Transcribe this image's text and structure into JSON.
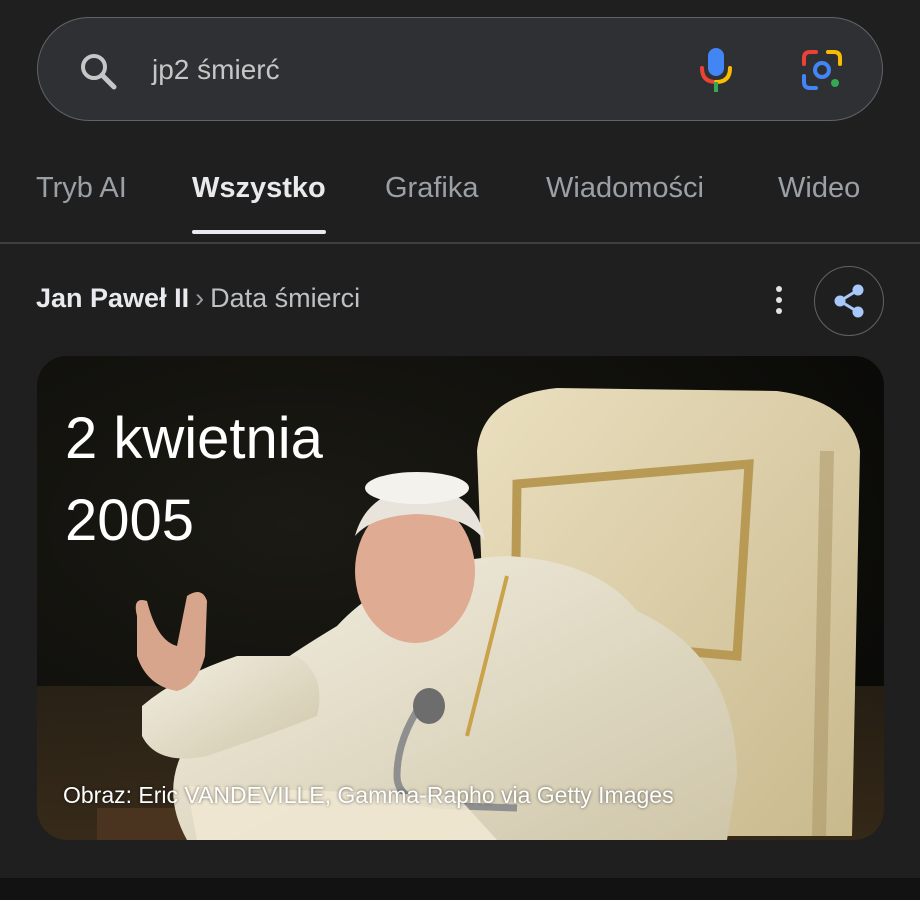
{
  "search": {
    "query": "jp2 śmierć",
    "icons": [
      "search-icon",
      "microphone-icon",
      "google-lens-icon"
    ]
  },
  "tabs": [
    {
      "label": "Tryb AI",
      "active": false
    },
    {
      "label": "Wszystko",
      "active": true
    },
    {
      "label": "Grafika",
      "active": false
    },
    {
      "label": "Wiadomości",
      "active": false
    },
    {
      "label": "Wideo",
      "active": false
    }
  ],
  "breadcrumb": {
    "entity": "Jan Paweł II",
    "separator": "›",
    "attribute": "Data śmierci"
  },
  "result": {
    "date_line1": "2 kwietnia",
    "date_line2": "2005",
    "image_credit": "Obraz: Eric VANDEVILLE, Gamma-Rapho via Getty Images"
  },
  "colors": {
    "background": "#1f1f1f",
    "search_bar": "#2f3033",
    "active_tab": "#e8eaed",
    "inactive_tab": "#9aa0a6",
    "share_icon": "#a8c7fa"
  }
}
